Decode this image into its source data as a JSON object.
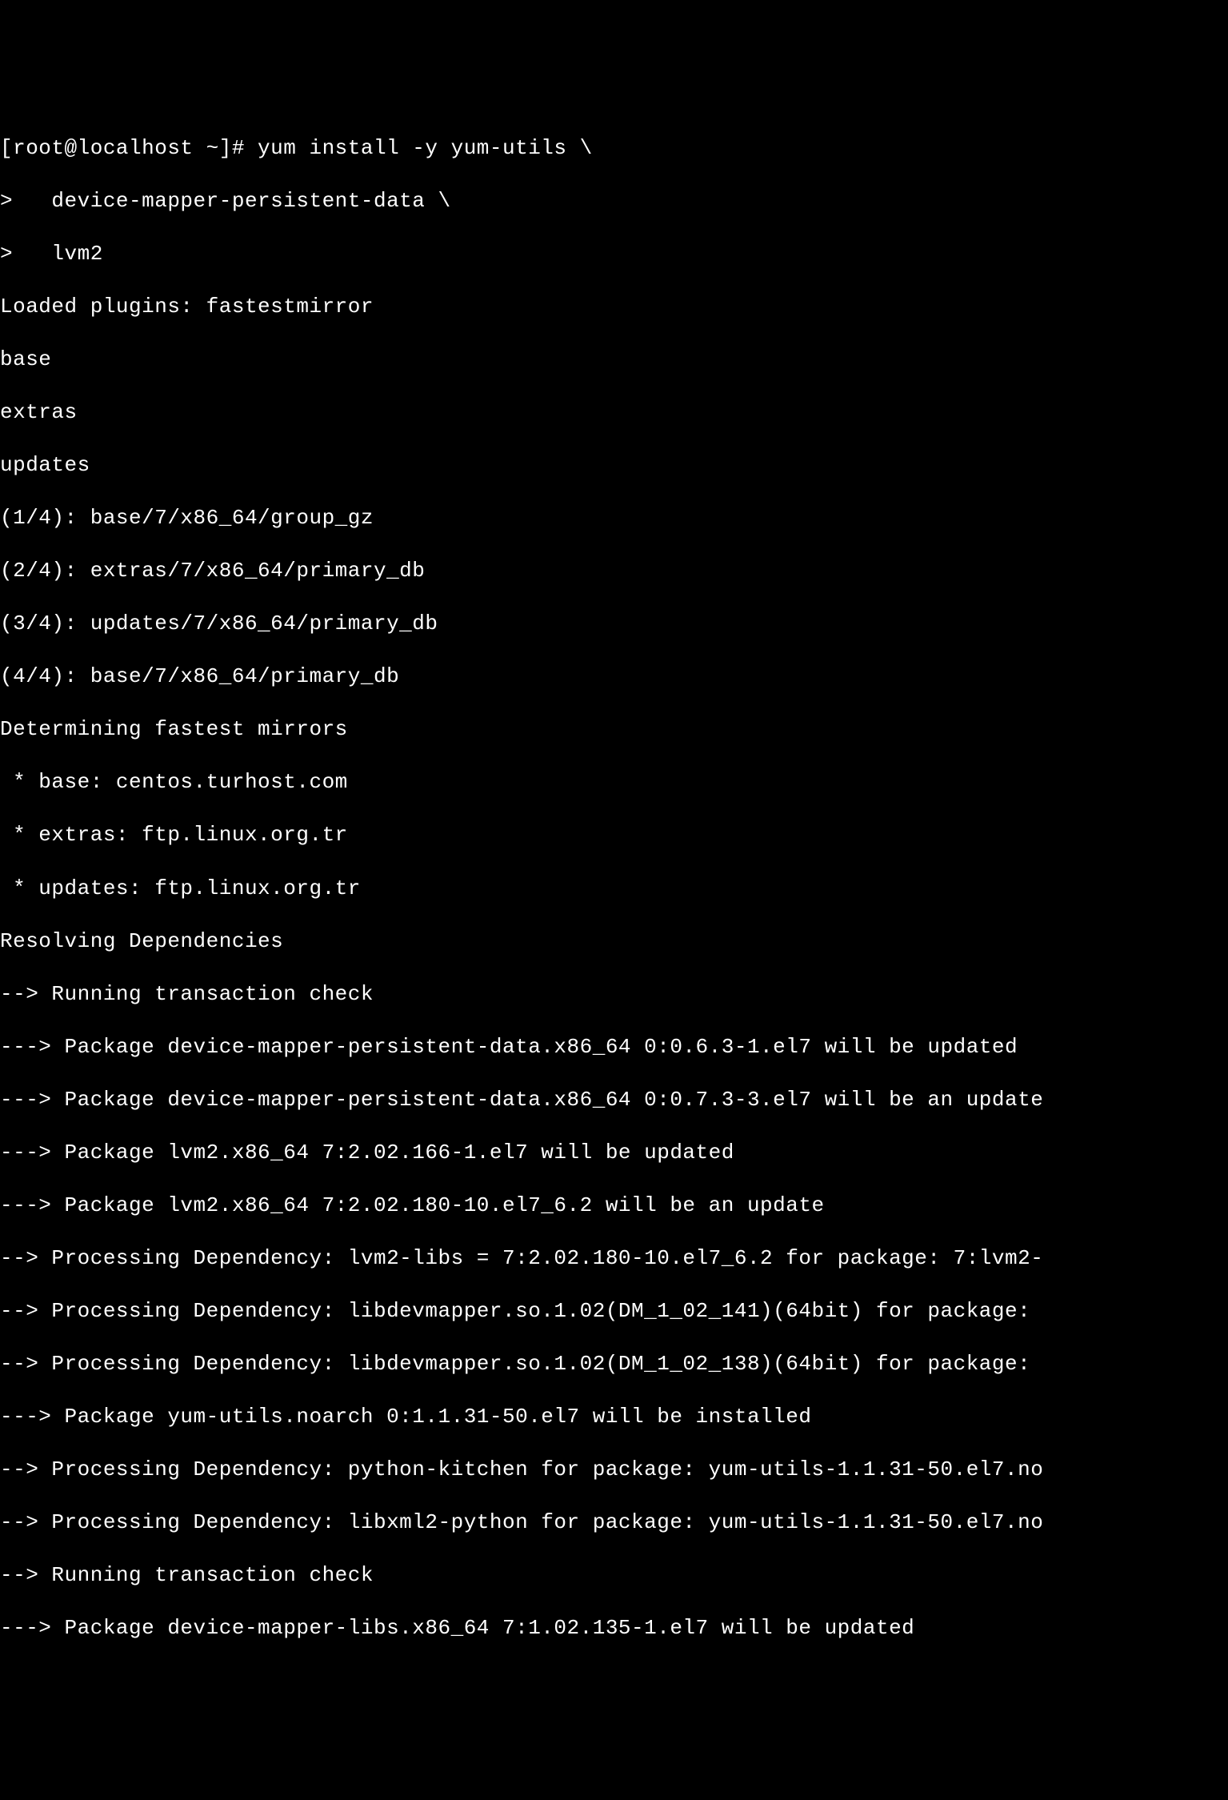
{
  "terminal": {
    "lines": [
      "[root@localhost ~]# yum install -y yum-utils \\",
      ">   device-mapper-persistent-data \\",
      ">   lvm2",
      "Loaded plugins: fastestmirror",
      "base",
      "extras",
      "updates",
      "(1/4): base/7/x86_64/group_gz",
      "(2/4): extras/7/x86_64/primary_db",
      "(3/4): updates/7/x86_64/primary_db",
      "(4/4): base/7/x86_64/primary_db",
      "Determining fastest mirrors",
      " * base: centos.turhost.com",
      " * extras: ftp.linux.org.tr",
      " * updates: ftp.linux.org.tr",
      "Resolving Dependencies",
      "--> Running transaction check",
      "---> Package device-mapper-persistent-data.x86_64 0:0.6.3-1.el7 will be updated",
      "---> Package device-mapper-persistent-data.x86_64 0:0.7.3-3.el7 will be an update",
      "---> Package lvm2.x86_64 7:2.02.166-1.el7 will be updated",
      "---> Package lvm2.x86_64 7:2.02.180-10.el7_6.2 will be an update",
      "--> Processing Dependency: lvm2-libs = 7:2.02.180-10.el7_6.2 for package: 7:lvm2-",
      "--> Processing Dependency: libdevmapper.so.1.02(DM_1_02_141)(64bit) for package: ",
      "--> Processing Dependency: libdevmapper.so.1.02(DM_1_02_138)(64bit) for package: ",
      "---> Package yum-utils.noarch 0:1.1.31-50.el7 will be installed",
      "--> Processing Dependency: python-kitchen for package: yum-utils-1.1.31-50.el7.no",
      "--> Processing Dependency: libxml2-python for package: yum-utils-1.1.31-50.el7.no",
      "--> Running transaction check",
      "---> Package device-mapper-libs.x86_64 7:1.02.135-1.el7 will be updated"
    ]
  }
}
